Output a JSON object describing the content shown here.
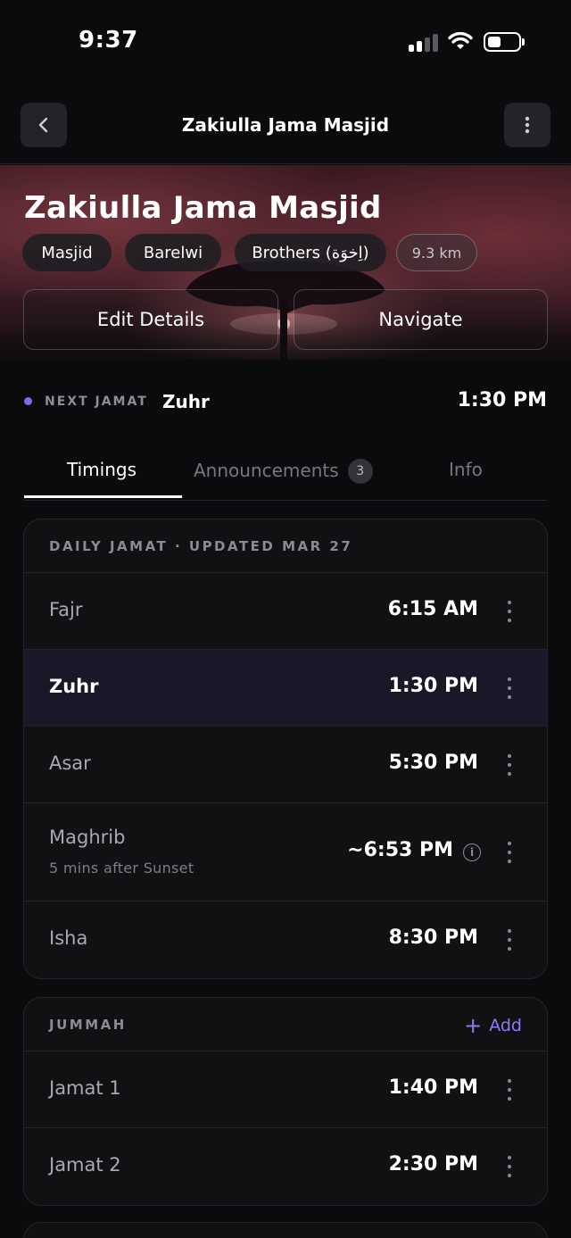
{
  "status_bar": {
    "time": "9:37"
  },
  "nav": {
    "title": "Zakiulla Jama Masjid"
  },
  "hero": {
    "title": "Zakiulla Jama Masjid",
    "chips": [
      "Masjid",
      "Barelwi",
      "Brothers (اِخوَة)"
    ],
    "distance": "9.3 km",
    "edit_label": "Edit Details",
    "navigate_label": "Navigate"
  },
  "next_jamat": {
    "label": "NEXT JAMAT",
    "name": "Zuhr",
    "time": "1:30 PM"
  },
  "tabs": {
    "timings": "Timings",
    "announcements": "Announcements",
    "announcements_count": "3",
    "info": "Info"
  },
  "daily": {
    "header": "DAILY JAMAT · UPDATED MAR 27",
    "rows": [
      {
        "name": "Fajr",
        "time": "6:15 AM"
      },
      {
        "name": "Zuhr",
        "time": "1:30 PM"
      },
      {
        "name": "Asar",
        "time": "5:30 PM"
      },
      {
        "name": "Maghrib",
        "sub": "5 mins after Sunset",
        "time": "~6:53 PM"
      },
      {
        "name": "Isha",
        "time": "8:30 PM"
      }
    ]
  },
  "jummah": {
    "header": "JUMMAH",
    "add_label": "Add",
    "rows": [
      {
        "name": "Jamat 1",
        "time": "1:40 PM"
      },
      {
        "name": "Jamat 2",
        "time": "2:30 PM"
      }
    ]
  },
  "colors": {
    "accent": "#7b6cf0",
    "background": "#0b0b0d",
    "card": "#111113",
    "highlight_row": "#181828"
  }
}
